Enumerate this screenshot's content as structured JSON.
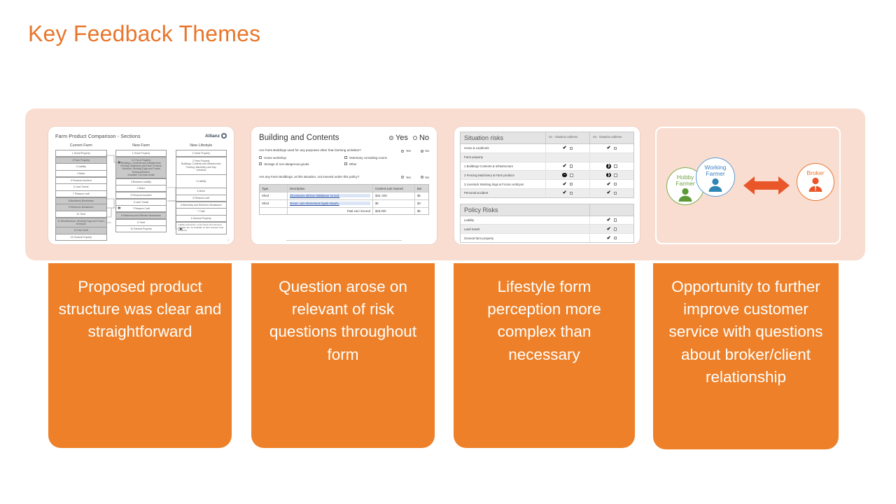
{
  "slide": {
    "title": "Key Feedback Themes",
    "accent_color": "#E8762C",
    "card_color": "#ED8028",
    "panel_color": "#FADDD1"
  },
  "themes": [
    {
      "caption": "Proposed product structure was clear and straightforward"
    },
    {
      "caption": "Question arose on relevant of risk questions throughout form"
    },
    {
      "caption": "Lifestyle form perception more complex than necessary"
    },
    {
      "caption": "Opportunity to further improve customer service with questions about broker/client relationship"
    }
  ],
  "thumb1": {
    "title": "Farm Product Comparison - Sections",
    "brand": "Allianz",
    "page_number": "1",
    "columns": [
      {
        "heading": "Current Farm",
        "items": [
          {
            "label": "1 Home/Property",
            "highlight": false
          },
          {
            "label": "2 Farm Property",
            "highlight": true
          },
          {
            "label": "3 Liability",
            "highlight": false
          },
          {
            "label": "4 Motor",
            "highlight": false
          },
          {
            "label": "5 Personal Accident",
            "highlight": false
          },
          {
            "label": "6 Land Transit",
            "highlight": false
          },
          {
            "label": "7 Pleasure craft",
            "highlight": false
          },
          {
            "label": "8 Machinery Breakdown",
            "highlight": true
          },
          {
            "label": "9 Electronic Breakdown",
            "highlight": true
          },
          {
            "label": "10 Theft",
            "highlight": false
          },
          {
            "label": "11 Miscellaneous: Working Dogs and Frozen Embryos",
            "highlight": true
          },
          {
            "label": "12 Farm theft",
            "highlight": true
          },
          {
            "label": "13 General Property",
            "highlight": false
          }
        ]
      },
      {
        "heading": "New Farm",
        "items": [
          {
            "label": "1 Home Property",
            "highlight": false
          },
          {
            "label": "2.2 Farm Property",
            "highlight": true
          },
          {
            "label": "3 Business Liability",
            "highlight": false
          },
          {
            "label": "4 Motor",
            "highlight": false
          },
          {
            "label": "5 Personal Accident",
            "highlight": false
          },
          {
            "label": "6 Land Transit",
            "highlight": false
          },
          {
            "label": "7 Pleasure Craft",
            "highlight": false
          },
          {
            "label": "8 Machinery and Effective Breakdown",
            "highlight": true
          },
          {
            "label": "9 Theft",
            "highlight": false
          },
          {
            "label": "10 General Property",
            "highlight": false
          }
        ],
        "sub_items": [
          "Buildings, Contents and Infrastructure",
          "Fencing, Machinery and Farm Produce",
          "Livestock, Working Dogs and Frozen Embryos/Semen"
        ],
        "sub_note": "Included: Car truck rental"
      },
      {
        "heading": "New Lifestyle",
        "items": [
          {
            "label": "1 Home Property",
            "highlight": false
          },
          {
            "label": "2 Farm Property",
            "highlight": false
          },
          {
            "label": "3 Liability",
            "highlight": false
          },
          {
            "label": "4 Motor",
            "highlight": false
          },
          {
            "label": "5 Pleasure craft",
            "highlight": false
          },
          {
            "label": "6 Machinery and Electronic Breakdown",
            "highlight": false
          },
          {
            "label": "7 Theft",
            "highlight": false
          },
          {
            "label": "8 General Property",
            "highlight": false
          }
        ],
        "sub_items": [
          "Buildings, Contents and Infrastructure",
          "Fencing, Machinery and Hay",
          "Livestock"
        ],
        "sub_note": "Liability description: Land Transit and Personal Accident are not available on New Lifestyle (sold products)"
      }
    ]
  },
  "thumb2": {
    "title": "Building and Contents",
    "toggle": {
      "yes": "Yes",
      "no": "No",
      "selected": "Yes"
    },
    "question1": {
      "text": "Are Farm Buildings used for any purposes other than farming activities?",
      "yes": "Yes",
      "no": "No",
      "selected": "No",
      "checkboxes_left": [
        "Home workshop",
        "Storage of non-dangerous goods"
      ],
      "checkboxes_right": [
        "Veterinary consulting rooms",
        "Other"
      ]
    },
    "question2": {
      "text": "Are any Farm Buildings, at this situation, not insured under this policy?",
      "yes": "Yes",
      "no": "No",
      "selected": "No"
    },
    "table": {
      "headers": [
        "Type",
        "Description",
        "Content sum insured",
        "Bui"
      ],
      "rows": [
        {
          "type": "Shed",
          "description": "Sit posuere ultrices habitasse mi sed.",
          "content": "$25, 000",
          "building": "$5"
        },
        {
          "type": "Shed",
          "description": "Donec cum elementum ligula mauris.",
          "content": "$0",
          "building": "$3"
        }
      ],
      "total_label": "Total sum insured",
      "total_content": "$25,000",
      "total_building": "$5"
    }
  },
  "thumb3": {
    "section1": {
      "title": "Situation risks",
      "col1": "S1 - Situation address",
      "col2": "S2 - Situation address",
      "rows": [
        {
          "label": "Home & Landlords",
          "s1": "tick",
          "s2": "tick",
          "alt": false
        },
        {
          "label": "Farm property",
          "s1": "",
          "s2": "",
          "alt": true
        },
        {
          "label": "1 Buildings Contents & Infrastructure",
          "s1": "tick",
          "s2": "dot",
          "alt": false
        },
        {
          "label": "2 Fencing Machinery & Farm produce",
          "s1": "dash",
          "s2": "dot",
          "alt": true
        },
        {
          "label": "3 Livestock Working dogs & Frozen embryos",
          "s1": "tick",
          "s2": "tick",
          "alt": false
        },
        {
          "label": "Personal accident",
          "s1": "tick",
          "s2": "tick",
          "alt": true
        }
      ]
    },
    "section2": {
      "title": "Policy Risks",
      "rows": [
        {
          "label": "Liability",
          "value": "tick",
          "alt": false
        },
        {
          "label": "Land transit",
          "value": "tick",
          "alt": true
        },
        {
          "label": "General farm property",
          "value": "tick",
          "alt": false
        }
      ]
    }
  },
  "thumb4": {
    "hobby_farmer": "Hobby Farmer",
    "working_farmer": "Working Farmer",
    "broker": "Broker",
    "colors": {
      "hobby": "#7AAF4C",
      "working": "#5B9BD5",
      "broker": "#E8762C"
    }
  }
}
